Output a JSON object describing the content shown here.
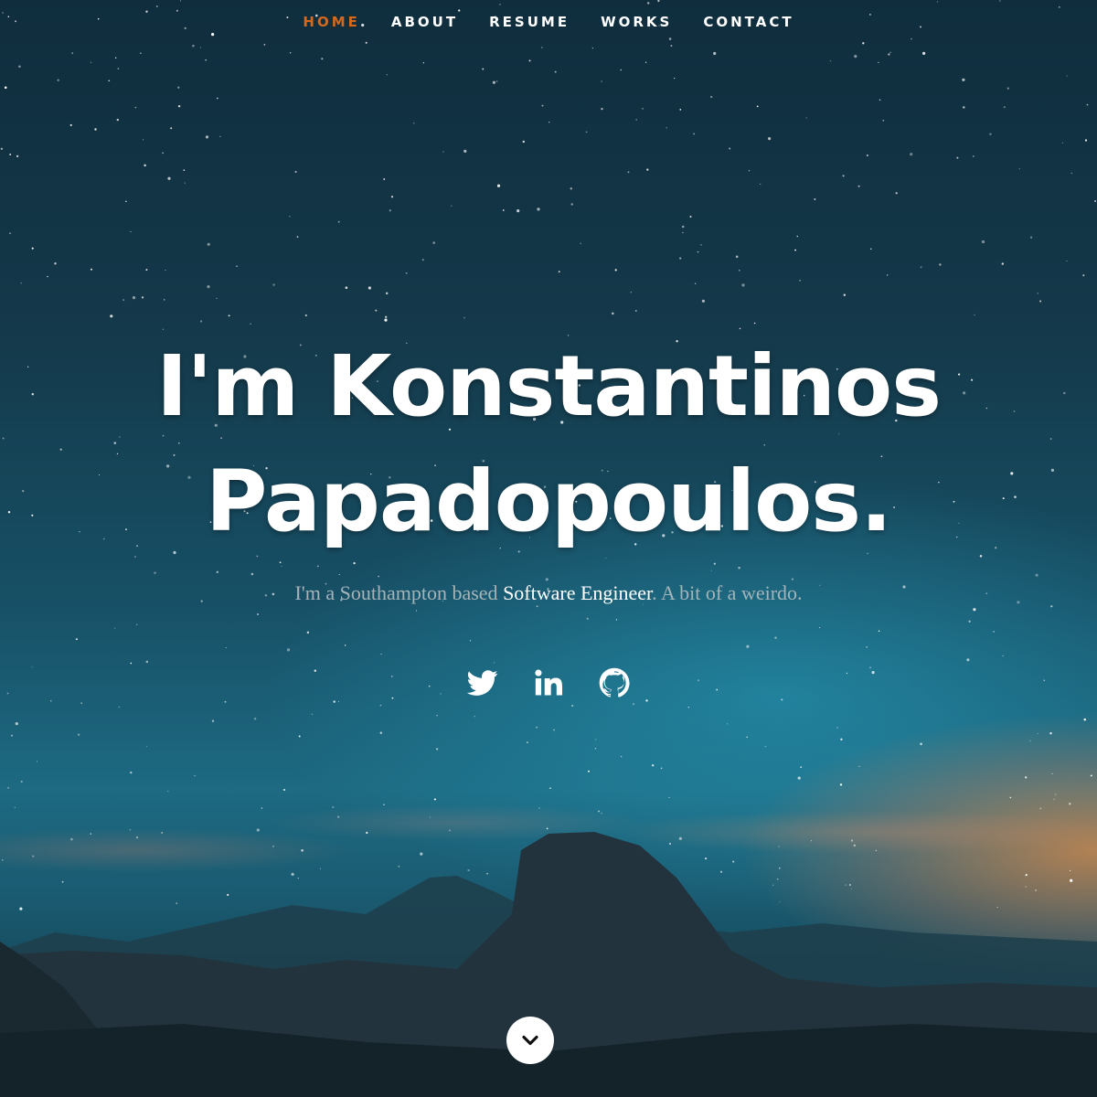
{
  "nav": {
    "items": [
      {
        "label": "HOME",
        "active": true
      },
      {
        "label": "ABOUT",
        "active": false
      },
      {
        "label": "RESUME",
        "active": false
      },
      {
        "label": "WORKS",
        "active": false
      },
      {
        "label": "CONTACT",
        "active": false
      }
    ],
    "active_color": "#d2691e"
  },
  "hero": {
    "title_line1": "I'm Konstantinos",
    "title_line2": "Papadopoulos.",
    "subtitle_prefix": "I'm a Southampton based ",
    "subtitle_highlight": "Software Engineer",
    "subtitle_suffix": ". A bit of a weirdo."
  },
  "social": {
    "icons": [
      "twitter-icon",
      "linkedin-icon",
      "github-icon"
    ]
  },
  "scroll_button": {
    "icon": "chevron-down-icon"
  }
}
